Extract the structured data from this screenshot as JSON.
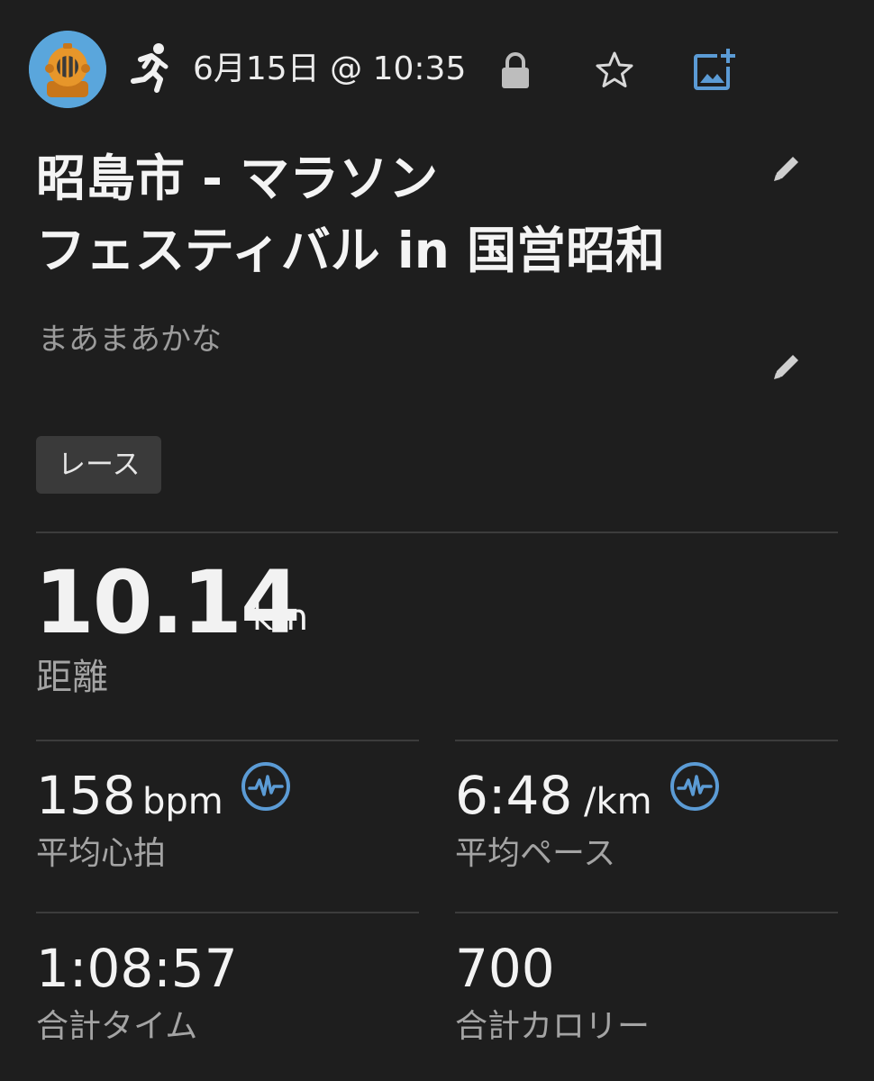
{
  "header": {
    "avatar_icon": "diving-helmet-avatar",
    "activity_icon": "running-icon",
    "date_time": "6月15日 @ 10:35",
    "icons": [
      "lock-icon",
      "star-icon",
      "add-photo-icon"
    ],
    "accent_color": "#5b9bd5"
  },
  "activity": {
    "title_line1": "昭島市 - マラソン",
    "title_line2": "フェスティバル in 国営昭和",
    "description": "まあまあかな",
    "tag": "レース"
  },
  "stats": {
    "distance": {
      "value": "10.14",
      "unit": "km",
      "label": "距離"
    },
    "avg_heart_rate": {
      "value": "158",
      "unit": "bpm",
      "label": "平均心拍"
    },
    "avg_pace": {
      "value": "6:48",
      "unit": "/km",
      "label": "平均ペース"
    },
    "total_time": {
      "value": "1:08:57",
      "label": "合計タイム"
    },
    "total_calories": {
      "value": "700",
      "label": "合計カロリー"
    }
  }
}
